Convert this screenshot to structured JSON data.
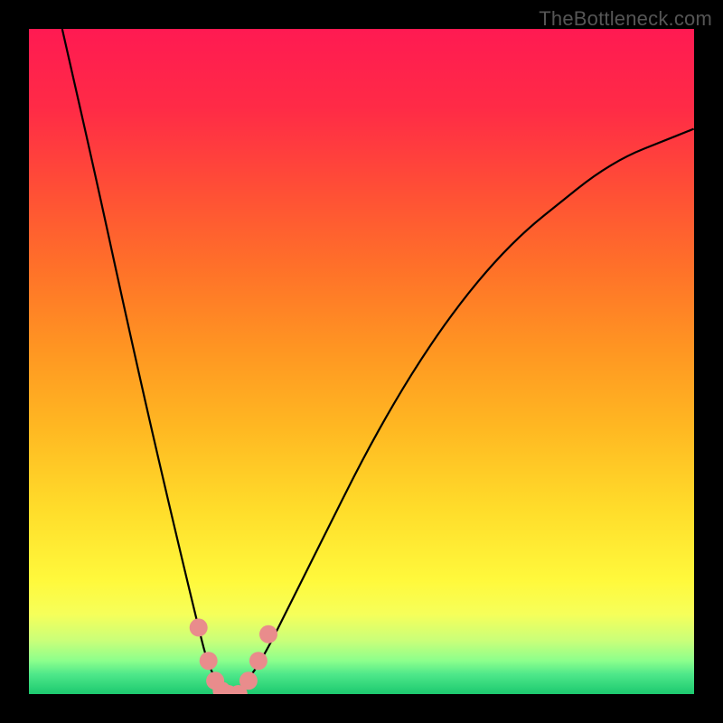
{
  "watermark": "TheBottleneck.com",
  "chart_data": {
    "type": "line",
    "title": "",
    "xlabel": "",
    "ylabel": "",
    "xlim": [
      0,
      100
    ],
    "ylim": [
      0,
      100
    ],
    "grid": false,
    "legend": false,
    "series": [
      {
        "name": "bottleneck-curve",
        "color": "#000000",
        "x": [
          5,
          10,
          15,
          20,
          25,
          27,
          29,
          30,
          32,
          35,
          40,
          45,
          50,
          55,
          60,
          65,
          70,
          75,
          80,
          85,
          90,
          95,
          100
        ],
        "y": [
          100,
          78,
          55,
          33,
          12,
          4,
          1,
          0,
          1,
          5,
          15,
          25,
          35,
          44,
          52,
          59,
          65,
          70,
          74,
          78,
          81,
          83,
          85
        ]
      }
    ],
    "markers": [
      {
        "x": 25.5,
        "y": 10,
        "color": "#e98c8c"
      },
      {
        "x": 27.0,
        "y": 5,
        "color": "#e98c8c"
      },
      {
        "x": 28.0,
        "y": 2,
        "color": "#e98c8c"
      },
      {
        "x": 29.0,
        "y": 0.5,
        "color": "#e98c8c"
      },
      {
        "x": 30.0,
        "y": 0,
        "color": "#e98c8c"
      },
      {
        "x": 31.5,
        "y": 0,
        "color": "#e98c8c"
      },
      {
        "x": 33.0,
        "y": 2,
        "color": "#e98c8c"
      },
      {
        "x": 34.5,
        "y": 5,
        "color": "#e98c8c"
      },
      {
        "x": 36.0,
        "y": 9,
        "color": "#e98c8c"
      }
    ],
    "background_gradient": {
      "type": "vertical",
      "stops": [
        {
          "pos": 0.0,
          "color": "#ff1a52"
        },
        {
          "pos": 0.12,
          "color": "#ff2b46"
        },
        {
          "pos": 0.24,
          "color": "#ff4e36"
        },
        {
          "pos": 0.36,
          "color": "#ff7129"
        },
        {
          "pos": 0.48,
          "color": "#ff9522"
        },
        {
          "pos": 0.6,
          "color": "#ffb822"
        },
        {
          "pos": 0.72,
          "color": "#ffdc2a"
        },
        {
          "pos": 0.83,
          "color": "#fff93c"
        },
        {
          "pos": 0.88,
          "color": "#f6ff5a"
        },
        {
          "pos": 0.92,
          "color": "#c9ff7a"
        },
        {
          "pos": 0.95,
          "color": "#8cff8c"
        },
        {
          "pos": 0.97,
          "color": "#4fe88a"
        },
        {
          "pos": 1.0,
          "color": "#1cc96f"
        }
      ]
    }
  }
}
